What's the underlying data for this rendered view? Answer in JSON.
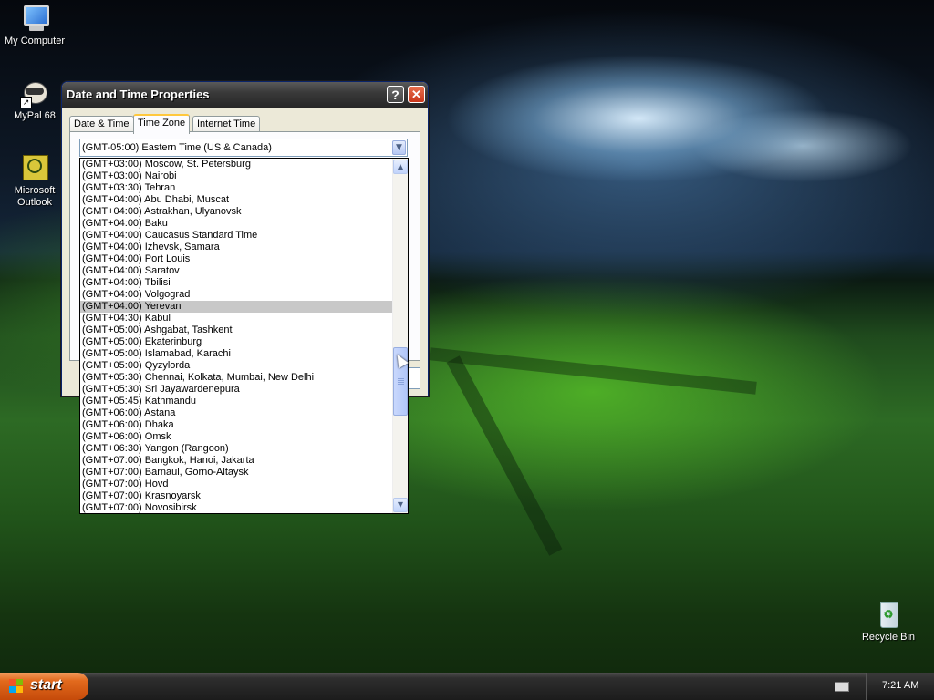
{
  "desktop": {
    "icons": [
      {
        "label": "My Computer"
      },
      {
        "label": "MyPal 68"
      },
      {
        "label": "Microsoft Outlook"
      },
      {
        "label": "Recycle Bin"
      }
    ]
  },
  "dialog": {
    "title": "Date and Time Properties",
    "help_glyph": "?",
    "close_glyph": "✕",
    "tabs": [
      {
        "label": "Date & Time",
        "active": false
      },
      {
        "label": "Time Zone",
        "active": true
      },
      {
        "label": "Internet Time",
        "active": false
      }
    ],
    "timezone_combo": {
      "value": "(GMT-05:00) Eastern Time (US & Canada)"
    },
    "timezone_list": {
      "selected": "(GMT+04:00) Yerevan",
      "items": [
        "(GMT+03:00) Moscow, St. Petersburg",
        "(GMT+03:00) Nairobi",
        "(GMT+03:30) Tehran",
        "(GMT+04:00) Abu Dhabi, Muscat",
        "(GMT+04:00) Astrakhan, Ulyanovsk",
        "(GMT+04:00) Baku",
        "(GMT+04:00) Caucasus Standard Time",
        "(GMT+04:00) Izhevsk, Samara",
        "(GMT+04:00) Port Louis",
        "(GMT+04:00) Saratov",
        "(GMT+04:00) Tbilisi",
        "(GMT+04:00) Volgograd",
        "(GMT+04:00) Yerevan",
        "(GMT+04:30) Kabul",
        "(GMT+05:00) Ashgabat, Tashkent",
        "(GMT+05:00) Ekaterinburg",
        "(GMT+05:00) Islamabad, Karachi",
        "(GMT+05:00) Qyzylorda",
        "(GMT+05:30) Chennai, Kolkata, Mumbai, New Delhi",
        "(GMT+05:30) Sri Jayawardenepura",
        "(GMT+05:45) Kathmandu",
        "(GMT+06:00) Astana",
        "(GMT+06:00) Dhaka",
        "(GMT+06:00) Omsk",
        "(GMT+06:30) Yangon (Rangoon)",
        "(GMT+07:00) Bangkok, Hanoi, Jakarta",
        "(GMT+07:00) Barnaul, Gorno-Altaysk",
        "(GMT+07:00) Hovd",
        "(GMT+07:00) Krasnoyarsk",
        "(GMT+07:00) Novosibirsk"
      ]
    }
  },
  "taskbar": {
    "start_label": "start",
    "clock": "7:21 AM",
    "tray_icons": [
      "keyboard-icon"
    ]
  },
  "colors": {
    "selection_bg": "#c8c8c8",
    "start_button": "#e26a1d",
    "active_tab_accent": "#ffc83c"
  }
}
